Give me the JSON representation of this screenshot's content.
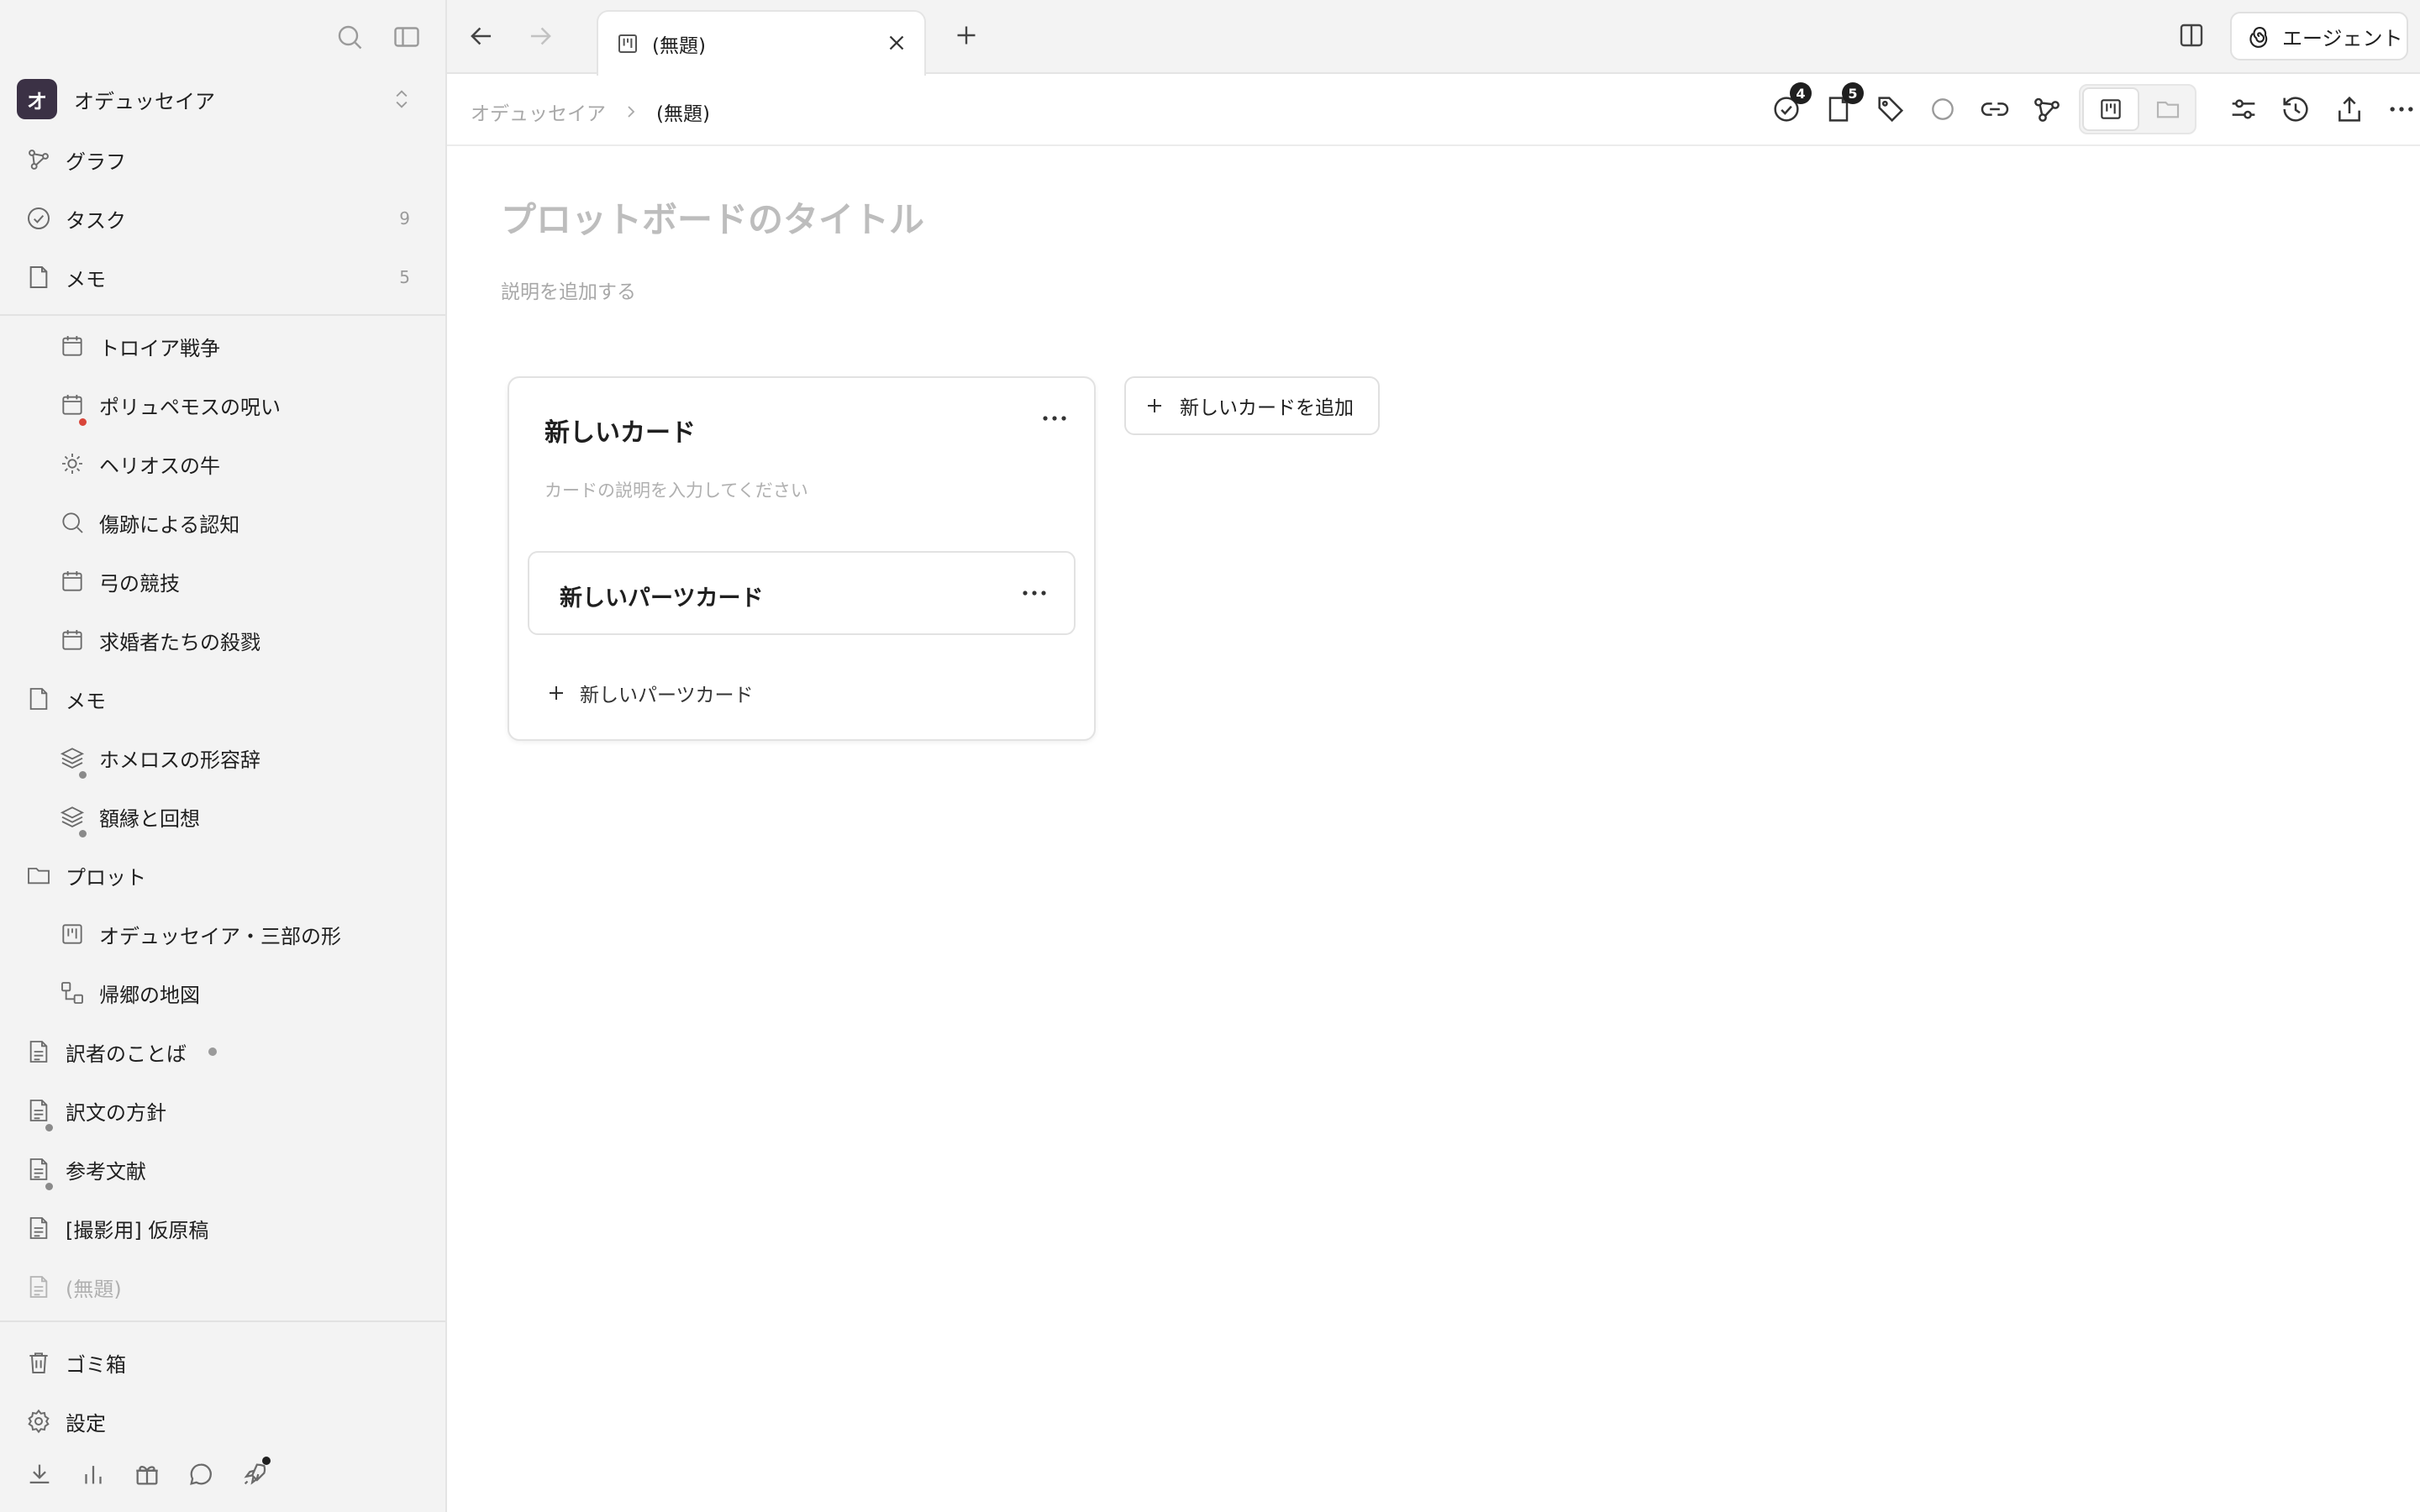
{
  "sidebar": {
    "workspace": {
      "initial": "オ",
      "name": "オデュッセイア"
    },
    "top_nav": [
      {
        "label": "グラフ",
        "icon": "graph-icon"
      },
      {
        "label": "タスク",
        "icon": "check-circle-icon",
        "count": "9"
      },
      {
        "label": "メモ",
        "icon": "note-icon",
        "count": "5"
      }
    ],
    "tree": [
      {
        "label": "トロイア戦争",
        "icon": "calendar-icon"
      },
      {
        "label": "ポリュペモスの呪い",
        "icon": "calendar-icon"
      },
      {
        "label": "ヘリオスの牛",
        "icon": "sun-icon"
      },
      {
        "label": "傷跡による認知",
        "icon": "search-icon"
      },
      {
        "label": "弓の競技",
        "icon": "calendar-icon"
      },
      {
        "label": "求婚者たちの殺戮",
        "icon": "calendar-icon"
      },
      {
        "label": "メモ",
        "icon": "note-icon"
      },
      {
        "label": "ホメロスの形容辞",
        "icon": "layers-icon"
      },
      {
        "label": "額縁と回想",
        "icon": "layers-icon"
      },
      {
        "label": "プロット",
        "icon": "folder-icon"
      },
      {
        "label": "オデュッセイア・三部の形",
        "icon": "board-icon"
      },
      {
        "label": "帰郷の地図",
        "icon": "flow-icon"
      },
      {
        "label": "訳者のことば",
        "icon": "document-icon"
      },
      {
        "label": "訳文の方針",
        "icon": "document-icon"
      },
      {
        "label": "参考文献",
        "icon": "document-icon"
      },
      {
        "label": "[撮影用] 仮原稿",
        "icon": "document-icon"
      },
      {
        "label": "(無題)",
        "icon": "document-icon"
      }
    ],
    "footer": [
      {
        "label": "ゴミ箱",
        "icon": "trash-icon"
      },
      {
        "label": "設定",
        "icon": "gear-icon"
      }
    ]
  },
  "tabbar": {
    "tab_title": "(無題)",
    "agent_label": "エージェント"
  },
  "toolbar": {
    "breadcrumb_root": "オデュッセイア",
    "breadcrumb_current": "(無題)",
    "tasks_badge": "4",
    "notes_badge": "5"
  },
  "board": {
    "title_placeholder": "プロットボードのタイトル",
    "description_placeholder": "説明を追加する",
    "card": {
      "title": "新しいカード",
      "description_placeholder": "カードの説明を入力してください",
      "part_card_title": "新しいパーツカード",
      "add_part_label": "新しいパーツカード"
    },
    "add_card_label": "新しいカードを追加"
  }
}
